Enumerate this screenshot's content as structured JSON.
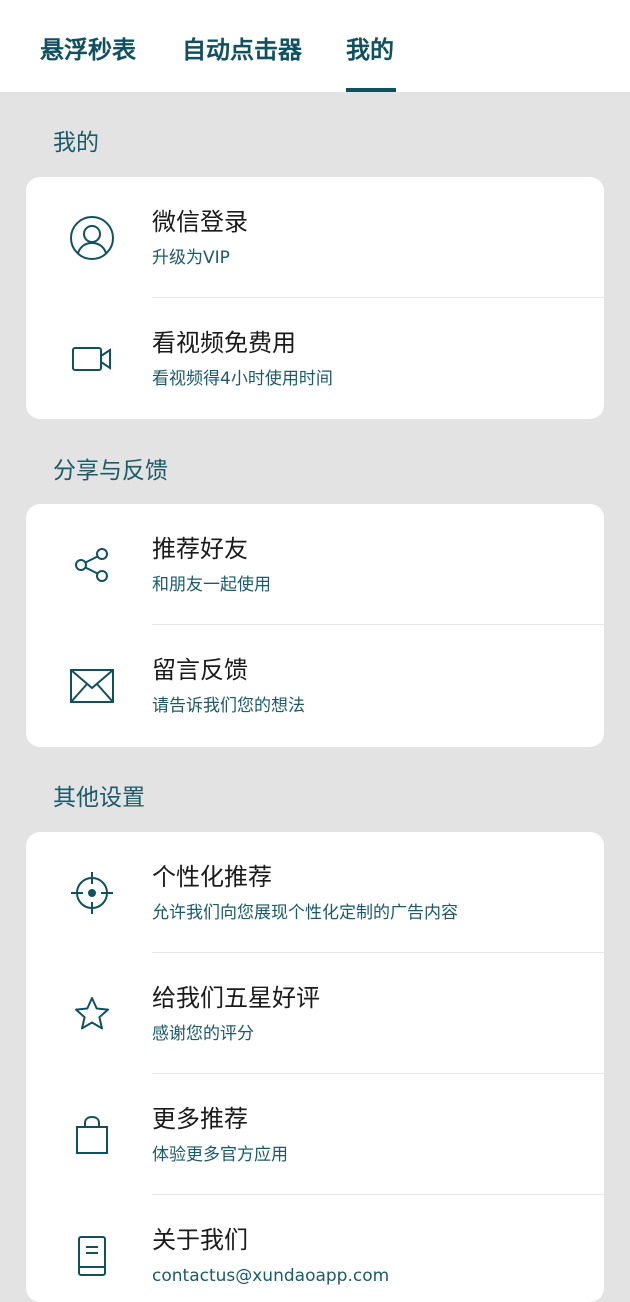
{
  "tabs": [
    {
      "label": "悬浮秒表"
    },
    {
      "label": "自动点击器"
    },
    {
      "label": "我的"
    }
  ],
  "active_tab": "我的",
  "accent_color": "#11505f",
  "sections": {
    "mine": {
      "title": "我的",
      "items": [
        {
          "title": "微信登录",
          "subtitle": "升级为VIP",
          "icon": "user-icon"
        },
        {
          "title": "看视频免费用",
          "subtitle": "看视频得4小时使用时间",
          "icon": "video-camera-icon"
        }
      ]
    },
    "share": {
      "title": "分享与反馈",
      "items": [
        {
          "title": "推荐好友",
          "subtitle": "和朋友一起使用",
          "icon": "share-icon"
        },
        {
          "title": "留言反馈",
          "subtitle": "请告诉我们您的想法",
          "icon": "mail-icon"
        }
      ]
    },
    "other": {
      "title": "其他设置",
      "items": [
        {
          "title": "个性化推荐",
          "subtitle": "允许我们向您展现个性化定制的广告内容",
          "icon": "crosshair-icon"
        },
        {
          "title": "给我们五星好评",
          "subtitle": "感谢您的评分",
          "icon": "star-icon"
        },
        {
          "title": "更多推荐",
          "subtitle": "体验更多官方应用",
          "icon": "shopping-bag-icon"
        },
        {
          "title": "关于我们",
          "subtitle": "contactus@xundaoapp.com",
          "icon": "book-icon"
        }
      ]
    }
  }
}
